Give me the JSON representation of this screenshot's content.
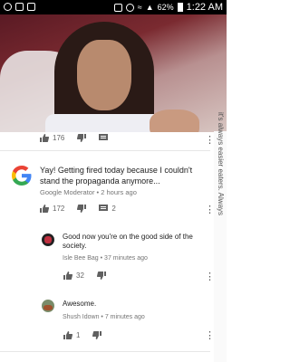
{
  "status_bar": {
    "battery": "62%",
    "clock": "1:22 AM"
  },
  "video": {
    "overlay_caption": "it's always easier eaters. Always"
  },
  "top_video_actions": {
    "likes": "176"
  },
  "comments": [
    {
      "author": "Google Moderator",
      "time": "2 hours ago",
      "text": "Yay! Getting fired today because I couldn't stand the propaganda anymore...",
      "likes": "172",
      "replies": "2",
      "replies_list": [
        {
          "author": "Isle Bee Bag",
          "time": "37 minutes ago",
          "text": "Good now you're on the good side of the society.",
          "likes": "32"
        },
        {
          "author": "Shush Idown",
          "time": "7 minutes ago",
          "text": "Awesome.",
          "likes": "1"
        }
      ]
    }
  ],
  "icons": {
    "like": "thumb-up-icon",
    "dislike": "thumb-down-icon",
    "reply": "comment-icon",
    "more": "more-vert-icon"
  },
  "colors": {
    "google_blue": "#4285f4",
    "google_red": "#ea4335",
    "google_yellow": "#fbbc05",
    "google_green": "#34a853"
  }
}
